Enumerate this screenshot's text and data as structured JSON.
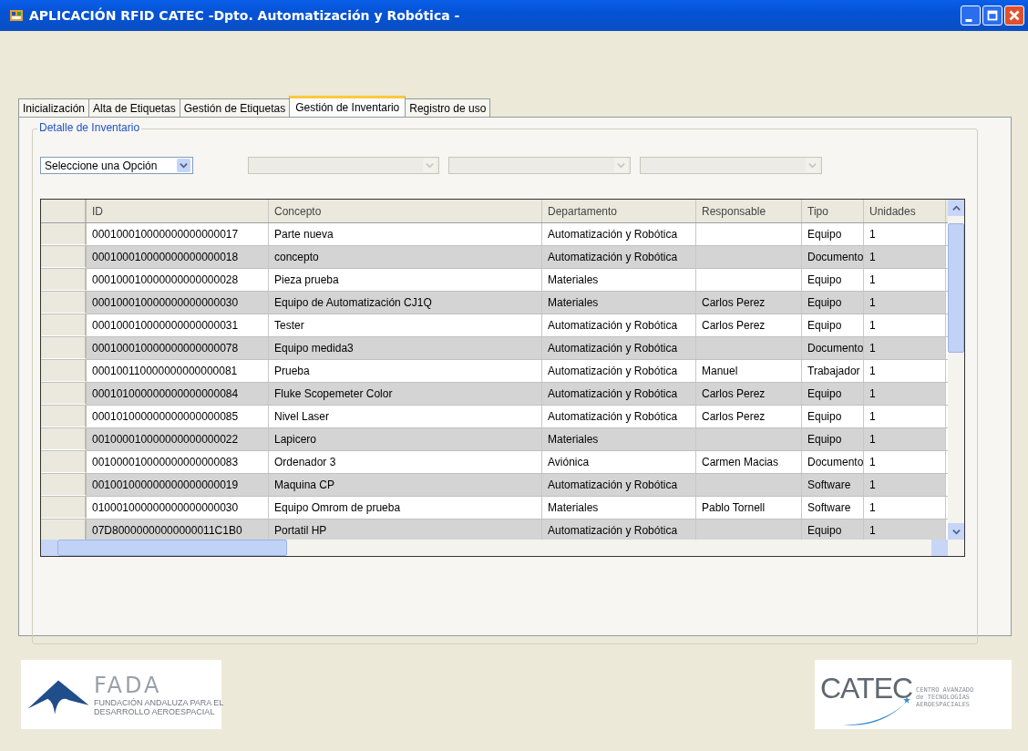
{
  "window": {
    "title": "APLICACIÓN RFID CATEC -Dpto. Automatización y Robótica -"
  },
  "tabs": [
    {
      "label": "Inicialización",
      "selected": false
    },
    {
      "label": "Alta de Etiquetas",
      "selected": false
    },
    {
      "label": "Gestión de Etiquetas",
      "selected": false
    },
    {
      "label": "Gestión de Inventario",
      "selected": true
    },
    {
      "label": "Registro de uso",
      "selected": false
    }
  ],
  "group": {
    "title": "Detalle de Inventario"
  },
  "filters": [
    {
      "value": "Seleccione una Opción",
      "disabled": false
    },
    {
      "disabled": true
    },
    {
      "disabled": true
    },
    {
      "disabled": true
    }
  ],
  "table": {
    "columns": [
      "ID",
      "Concepto",
      "Departamento",
      "Responsable",
      "Tipo",
      "Unidades"
    ],
    "rows": [
      [
        "000100010000000000000017",
        "Parte nueva",
        "Automatización y Robótica",
        "",
        "Equipo",
        "1"
      ],
      [
        "000100010000000000000018",
        "concepto",
        "Automatización y Robótica",
        "",
        "Documento",
        "1"
      ],
      [
        "000100010000000000000028",
        "Pieza prueba",
        "Materiales",
        "",
        "Equipo",
        "1"
      ],
      [
        "000100010000000000000030",
        "Equipo de Automatización CJ1Q",
        "Materiales",
        "Carlos Perez",
        "Equipo",
        "1"
      ],
      [
        "000100010000000000000031",
        "Tester",
        "Automatización y Robótica",
        "Carlos Perez",
        "Equipo",
        "1"
      ],
      [
        "000100010000000000000078",
        "Equipo medida3",
        "Automatización y Robótica",
        "",
        "Documento",
        "1"
      ],
      [
        "000100110000000000000081",
        "Prueba",
        "Automatización y Robótica",
        "Manuel",
        "Trabajador",
        "1"
      ],
      [
        "000101000000000000000084",
        "Fluke Scopemeter Color",
        "Automatización y Robótica",
        "Carlos Perez",
        "Equipo",
        "1"
      ],
      [
        "000101000000000000000085",
        "Nivel Laser",
        "Automatización y Robótica",
        "Carlos Perez",
        "Equipo",
        "1"
      ],
      [
        "001000010000000000000022",
        "Lapicero",
        "Materiales",
        "",
        "Equipo",
        "1"
      ],
      [
        "001000010000000000000083",
        "Ordenador 3",
        "Aviónica",
        "Carmen Macias",
        "Documento",
        "1"
      ],
      [
        "001001000000000000000019",
        "Maquina CP",
        "Automatización y Robótica",
        "",
        "Software",
        "1"
      ],
      [
        "010001000000000000000030",
        "Equipo Omrom de prueba",
        "Materiales",
        "Pablo Tornell",
        "Software",
        "1"
      ],
      [
        "07D80000000000000011C1B0",
        "Portatil HP",
        "Automatización y Robótica",
        "",
        "Equipo",
        "1"
      ]
    ]
  },
  "logos": [
    {
      "kind": "fada",
      "name": "FADA",
      "lines": [
        "FUNDACIÓN ANDALUZA PARA EL",
        "DESARROLLO AEROESPACIAL"
      ]
    },
    {
      "kind": "catec",
      "name": "CATEC",
      "lines": [
        "CENTRO AVANZADO",
        "de TECNOLOGÍAS",
        "AEROESPACIALES"
      ]
    }
  ]
}
